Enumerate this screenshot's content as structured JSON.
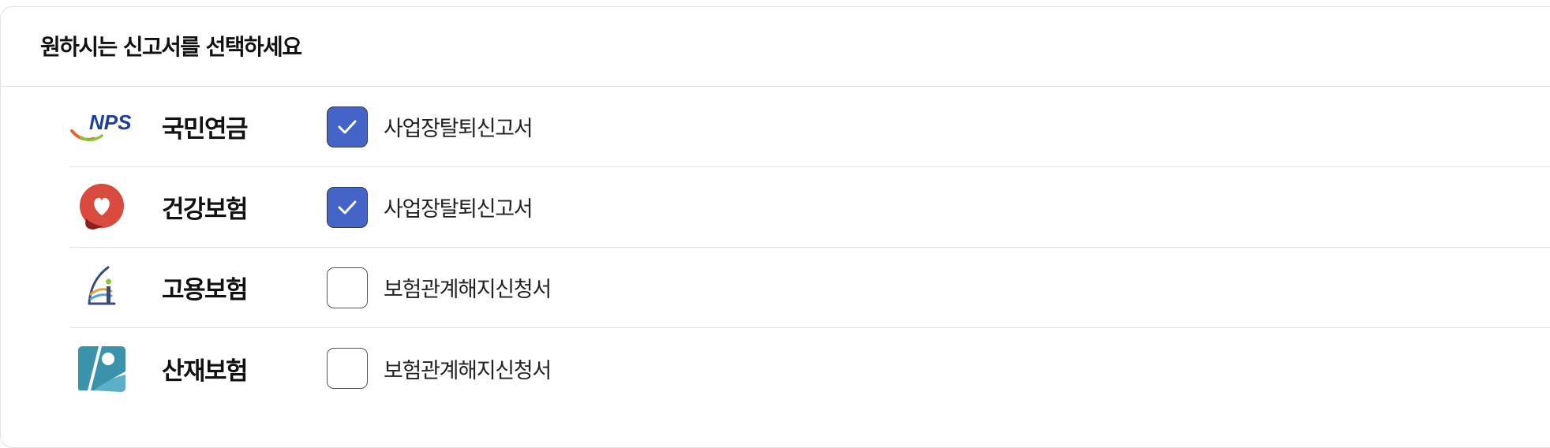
{
  "header": {
    "title": "원하시는 신고서를 선택하세요"
  },
  "agencies": [
    {
      "name": "국민연금",
      "logo": "nps-logo",
      "logo_text": "NPS",
      "document": "사업장탈퇴신고서",
      "checked": true
    },
    {
      "name": "건강보험",
      "logo": "nhis-heart-logo",
      "document": "사업장탈퇴신고서",
      "checked": true
    },
    {
      "name": "고용보험",
      "logo": "employment-insurance-logo",
      "document": "보험관계해지신청서",
      "checked": false
    },
    {
      "name": "산재보험",
      "logo": "industrial-accident-insurance-logo",
      "document": "보험관계해지신청서",
      "checked": false
    }
  ],
  "colors": {
    "checked_fill": "#4464c8",
    "divider": "#e2e2e2"
  }
}
